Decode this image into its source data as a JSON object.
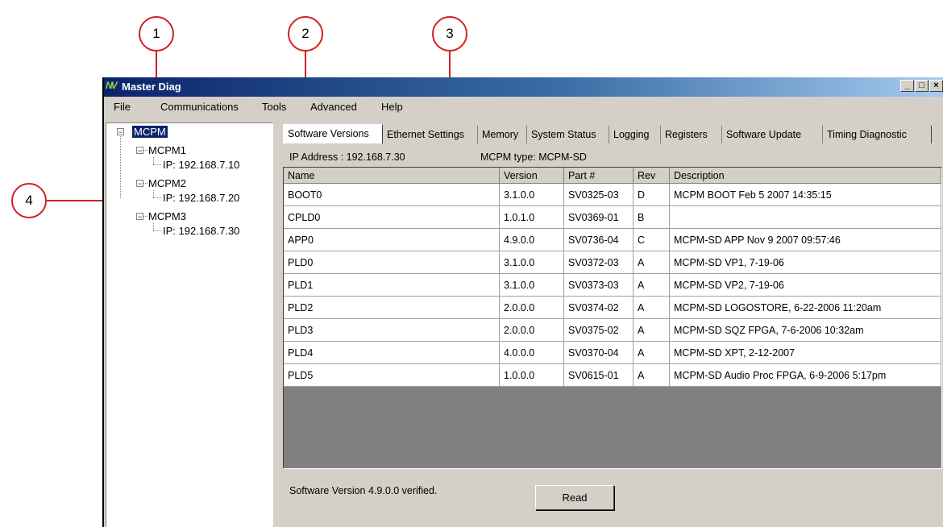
{
  "callouts": [
    "1",
    "2",
    "3",
    "4"
  ],
  "window": {
    "title": "Master Diag",
    "logo": "NV",
    "controls": [
      "_",
      "□",
      "×"
    ]
  },
  "menu": [
    "File",
    "Communications",
    "Tools",
    "Advanced",
    "Help"
  ],
  "tree": {
    "root": "MCPM",
    "nodes": [
      {
        "label": "MCPM1",
        "ip": "IP: 192.168.7.10"
      },
      {
        "label": "MCPM2",
        "ip": "IP: 192.168.7.20"
      },
      {
        "label": "MCPM3",
        "ip": "IP: 192.168.7.30"
      }
    ]
  },
  "tabs": [
    "Software Versions",
    "Ethernet Settings",
    "Memory",
    "System Status",
    "Logging",
    "Registers",
    "Software Update",
    "Timing Diagnostic"
  ],
  "active_tab": "Software Versions",
  "info": {
    "ip_address": "IP Address : 192.168.7.30",
    "mcpm_type": "MCPM type: MCPM-SD"
  },
  "table": {
    "headers": [
      "Name",
      "Version",
      "Part #",
      "Rev",
      "Description"
    ],
    "rows": [
      [
        "BOOT0",
        "3.1.0.0",
        "SV0325-03",
        "D",
        "MCPM BOOT Feb  5 2007 14:35:15"
      ],
      [
        "CPLD0",
        "1.0.1.0",
        "SV0369-01",
        "B",
        ""
      ],
      [
        "APP0",
        "4.9.0.0",
        "SV0736-04",
        "C",
        "MCPM-SD APP Nov  9 2007 09:57:46"
      ],
      [
        "PLD0",
        "3.1.0.0",
        "SV0372-03",
        "A",
        "MCPM-SD VP1, 7-19-06"
      ],
      [
        "PLD1",
        "3.1.0.0",
        "SV0373-03",
        "A",
        "MCPM-SD VP2, 7-19-06"
      ],
      [
        "PLD2",
        "2.0.0.0",
        "SV0374-02",
        "A",
        "MCPM-SD LOGOSTORE, 6-22-2006 11:20am"
      ],
      [
        "PLD3",
        "2.0.0.0",
        "SV0375-02",
        "A",
        "MCPM-SD SQZ FPGA, 7-6-2006 10:32am"
      ],
      [
        "PLD4",
        "4.0.0.0",
        "SV0370-04",
        "A",
        "MCPM-SD XPT, 2-12-2007"
      ],
      [
        "PLD5",
        "1.0.0.0",
        "SV0615-01",
        "A",
        "MCPM-SD Audio Proc FPGA, 6-9-2006 5:17pm"
      ]
    ]
  },
  "status": "Software Version 4.9.0.0 verified.",
  "read_button": "Read"
}
